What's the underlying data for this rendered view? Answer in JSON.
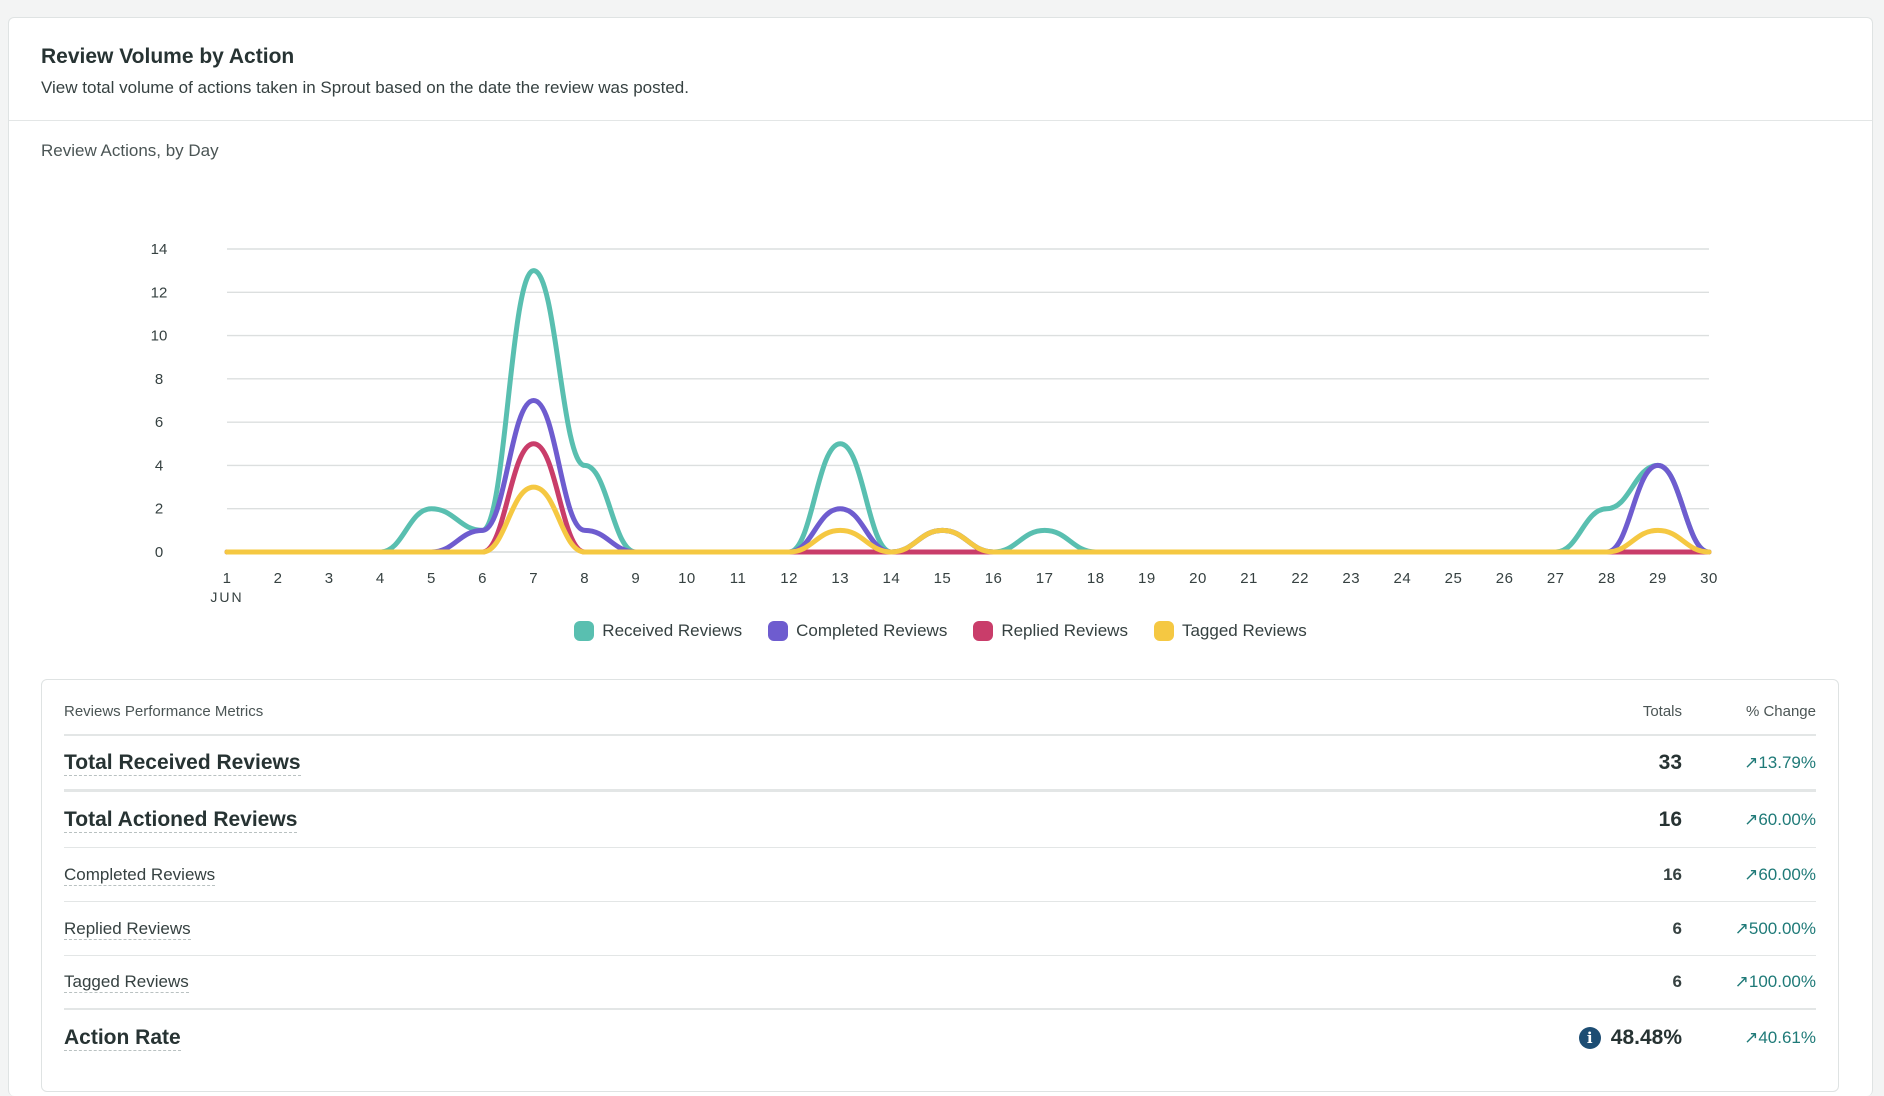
{
  "card": {
    "title": "Review Volume by Action",
    "subtitle": "View total volume of actions taken in Sprout based on the date the review was posted.",
    "chart_label": "Review Actions, by Day"
  },
  "chart_data": {
    "type": "line",
    "x": [
      1,
      2,
      3,
      4,
      5,
      6,
      7,
      8,
      9,
      10,
      11,
      12,
      13,
      14,
      15,
      16,
      17,
      18,
      19,
      20,
      21,
      22,
      23,
      24,
      25,
      26,
      27,
      28,
      29,
      30
    ],
    "x_month_label": "JUN",
    "ylim": [
      0,
      14
    ],
    "yticks": [
      0,
      2,
      4,
      6,
      8,
      10,
      12,
      14
    ],
    "grid": true,
    "legend_position": "bottom",
    "series": [
      {
        "name": "Received Reviews",
        "color": "#59bfb0",
        "values": [
          0,
          0,
          0,
          0,
          2,
          1,
          13,
          4,
          0,
          0,
          0,
          0,
          5,
          0,
          1,
          0,
          1,
          0,
          0,
          0,
          0,
          0,
          0,
          0,
          0,
          0,
          0,
          2,
          4,
          0
        ]
      },
      {
        "name": "Completed Reviews",
        "color": "#6e5ccf",
        "values": [
          0,
          0,
          0,
          0,
          0,
          1,
          7,
          1,
          0,
          0,
          0,
          0,
          2,
          0,
          1,
          0,
          0,
          0,
          0,
          0,
          0,
          0,
          0,
          0,
          0,
          0,
          0,
          0,
          4,
          0
        ]
      },
      {
        "name": "Replied Reviews",
        "color": "#c93d6a",
        "values": [
          0,
          0,
          0,
          0,
          0,
          0,
          5,
          0,
          0,
          0,
          0,
          0,
          0,
          0,
          0,
          0,
          0,
          0,
          0,
          0,
          0,
          0,
          0,
          0,
          0,
          0,
          0,
          0,
          0,
          0
        ]
      },
      {
        "name": "Tagged Reviews",
        "color": "#f5c842",
        "values": [
          0,
          0,
          0,
          0,
          0,
          0,
          3,
          0,
          0,
          0,
          0,
          0,
          1,
          0,
          1,
          0,
          0,
          0,
          0,
          0,
          0,
          0,
          0,
          0,
          0,
          0,
          0,
          0,
          1,
          0
        ]
      }
    ]
  },
  "metrics": {
    "header": {
      "name": "Reviews Performance Metrics",
      "totals": "Totals",
      "change": "% Change"
    },
    "rows": [
      {
        "name": "Total Received Reviews",
        "total": "33",
        "change": "13.79%"
      },
      {
        "name": "Total Actioned Reviews",
        "total": "16",
        "change": "60.00%"
      },
      {
        "name": "Completed Reviews",
        "total": "16",
        "change": "60.00%"
      },
      {
        "name": "Replied Reviews",
        "total": "6",
        "change": "500.00%"
      },
      {
        "name": "Tagged Reviews",
        "total": "6",
        "change": "100.00%"
      },
      {
        "name": "Action Rate",
        "total": "48.48%",
        "change": "40.61%"
      }
    ],
    "arrow_glyph": "↗",
    "info_glyph": "i"
  }
}
